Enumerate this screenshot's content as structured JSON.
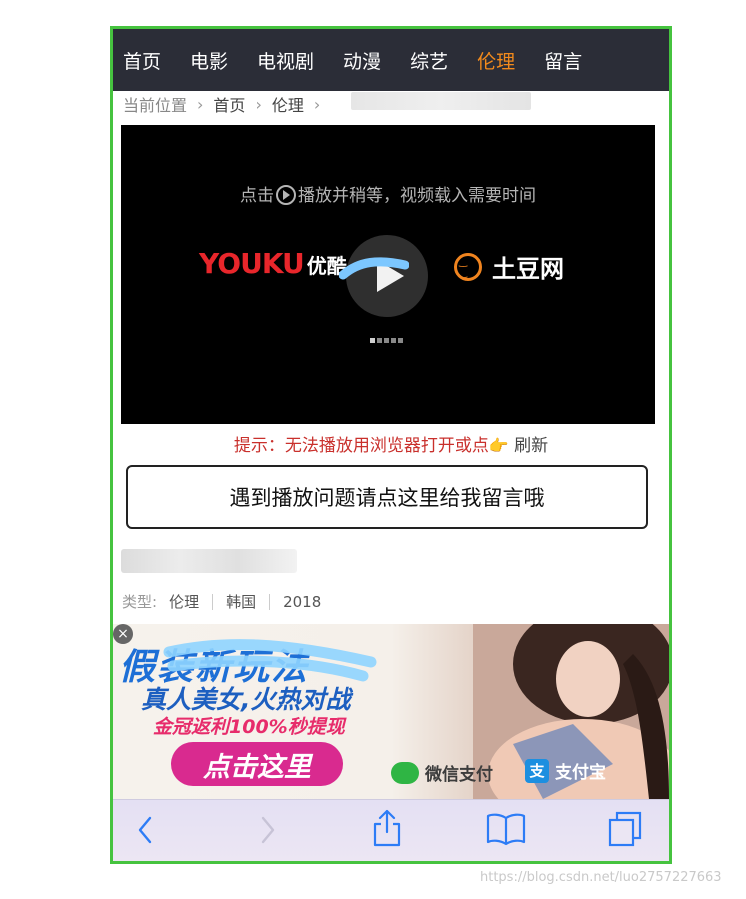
{
  "nav": {
    "items": [
      {
        "label": "首页",
        "active": false
      },
      {
        "label": "电影",
        "active": false
      },
      {
        "label": "电视剧",
        "active": false
      },
      {
        "label": "动漫",
        "active": false
      },
      {
        "label": "综艺",
        "active": false
      },
      {
        "label": "伦理",
        "active": true
      },
      {
        "label": "留言",
        "active": false
      }
    ],
    "active_color": "#f28a1c"
  },
  "breadcrumb": {
    "label": "当前位置",
    "items": [
      "首页",
      "伦理"
    ]
  },
  "player": {
    "hint_prefix": "点击",
    "hint_suffix": "播放并稍等，视频载入需要时间",
    "youku_logo": "YOUKU",
    "youku_cn": "优酷",
    "tudou_name": "土豆网"
  },
  "tip": {
    "text": "提示：无法播放用浏览器打开或点",
    "hand": "👉",
    "refresh": "刷新"
  },
  "message_button": "遇到播放问题请点这里给我留言哦",
  "meta": {
    "type_label": "类型:",
    "genre": "伦理",
    "region": "韩国",
    "year": "2018"
  },
  "ad": {
    "close": "×",
    "line1": "假装新玩法",
    "line2": "真人美女,火热对战",
    "line3": "金冠返利100%秒提现",
    "cta": "点击这里",
    "wechat": "微信支付",
    "alipay": "支付宝",
    "alipay_icon": "支"
  },
  "watermark": "https://blog.csdn.net/luo2757227663"
}
